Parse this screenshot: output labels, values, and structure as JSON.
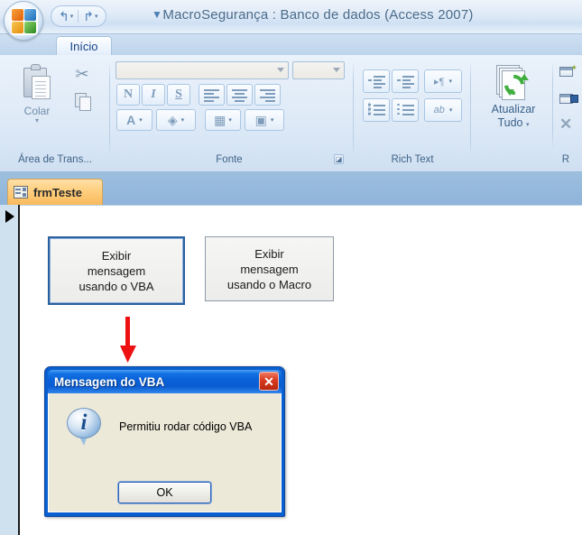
{
  "window": {
    "title": "MacroSegurança : Banco de dados (Access 2007)",
    "orb_name": "office-button",
    "quick_access": [
      {
        "name": "undo",
        "glyph": "↰",
        "caret": "▾"
      },
      {
        "name": "redo",
        "glyph": "↱",
        "caret": "▾"
      }
    ],
    "qat_more": "▼"
  },
  "ribbon": {
    "tabs": [
      {
        "label": "Início",
        "active": true
      }
    ],
    "groups": [
      {
        "label": "Área de Trans...",
        "paste_label": "Colar",
        "paste_caret": "▾",
        "buttons": [
          {
            "name": "cut",
            "label": "Recortar"
          },
          {
            "name": "copy",
            "label": "Copiar"
          }
        ]
      },
      {
        "label": "Fonte",
        "font_name_value": "",
        "font_size_value": "",
        "bold": "N",
        "italic": "I",
        "underline": "S",
        "align_left": "align-left",
        "align_center": "align-center",
        "align_right": "align-right",
        "font_color": "A",
        "fill_color": "fill",
        "gridlines": "grid",
        "alt_fill": "alt-fill",
        "launcher": "◪"
      },
      {
        "label": "Rich Text",
        "buttons": [
          {
            "name": "decrease-indent"
          },
          {
            "name": "increase-indent"
          },
          {
            "name": "text-direction",
            "glyph": "▸¶"
          },
          {
            "name": "numbered-list"
          },
          {
            "name": "bulleted-list"
          },
          {
            "name": "text-highlight",
            "glyph": "ab"
          }
        ]
      },
      {
        "label": "R",
        "refresh_label_line1": "Atualizar",
        "refresh_label_line2": "Tudo",
        "refresh_caret": "▾",
        "records": [
          {
            "name": "new-record",
            "label": "N"
          },
          {
            "name": "save-record",
            "label": "S"
          },
          {
            "name": "delete-record",
            "label": "E"
          }
        ]
      }
    ]
  },
  "document_tabs": [
    {
      "label": "frmTeste",
      "icon": "form-icon",
      "active": true
    }
  ],
  "form": {
    "record_selector": "▶",
    "buttons": [
      {
        "name": "show-message-vba-button",
        "lines": [
          "Exibir",
          "mensagem",
          "usando o VBA"
        ],
        "selected": true
      },
      {
        "name": "show-message-macro-button",
        "lines": [
          "Exibir",
          "mensagem",
          "usando o Macro"
        ],
        "selected": false
      }
    ],
    "annotation_arrow": {
      "name": "red-down-arrow",
      "color": "#ee1111"
    }
  },
  "message_box": {
    "title": "Mensagem do VBA",
    "close_label": "✕",
    "icon": "information-icon",
    "icon_glyph": "i",
    "text": "Permitiu rodar código VBA",
    "ok_label": "OK"
  },
  "colors": {
    "titlebar_text": "#4a6b8a",
    "ribbon_group_text": "#3f6286",
    "doc_tab_bg": "#ffcf7e",
    "dialog_titlebar": "#0a5fd0",
    "dialog_body": "#ece9d8",
    "arrow_red": "#ee1111",
    "close_red": "#d93b20"
  }
}
